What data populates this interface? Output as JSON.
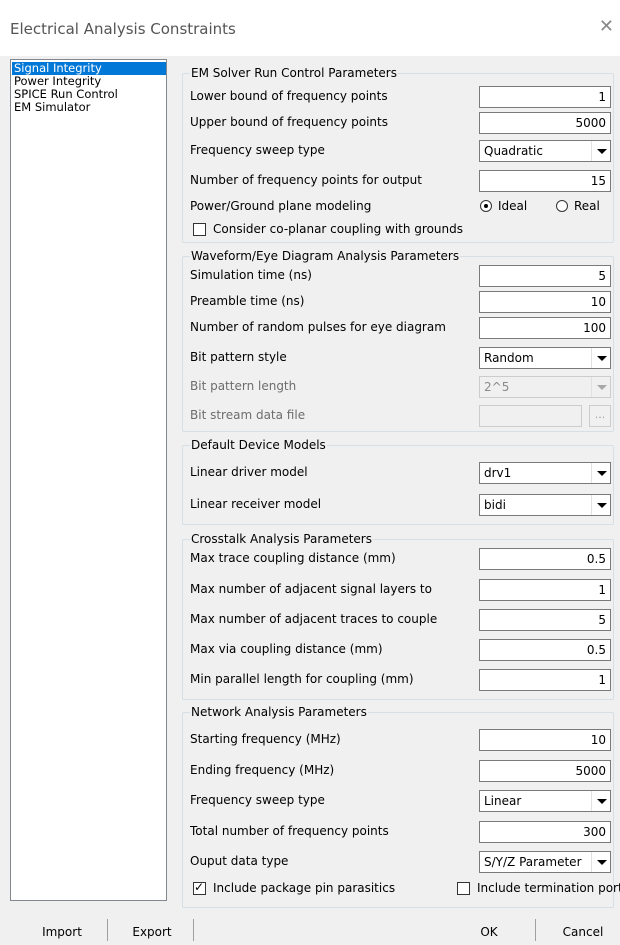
{
  "window": {
    "title": "Electrical Analysis Constraints",
    "close_glyph": "✕"
  },
  "sidebar": {
    "items": [
      {
        "label": "Signal Integrity",
        "selected": true
      },
      {
        "label": "Power Integrity"
      },
      {
        "label": "SPICE Run Control"
      },
      {
        "label": "EM Simulator"
      }
    ]
  },
  "em_solver": {
    "title": "EM Solver Run Control Parameters",
    "lower_bound": {
      "label": "Lower bound of frequency points",
      "value": "1"
    },
    "upper_bound": {
      "label": "Upper bound of frequency points",
      "value": "5000"
    },
    "sweep_type": {
      "label": "Frequency sweep type",
      "value": "Quadratic"
    },
    "output_points": {
      "label": "Number of frequency points for output",
      "value": "15"
    },
    "plane_modeling": {
      "label": "Power/Ground plane modeling",
      "option_ideal": "Ideal",
      "option_real": "Real",
      "selected": "Ideal"
    },
    "coplanar": {
      "label": "Consider co-planar coupling with grounds",
      "checked": false
    }
  },
  "waveform": {
    "title": "Waveform/Eye Diagram Analysis Parameters",
    "sim_time": {
      "label": "Simulation time (ns)",
      "value": "5"
    },
    "preamble": {
      "label": "Preamble time (ns)",
      "value": "10"
    },
    "random_pulses": {
      "label": "Number of random pulses for eye diagram",
      "value": "100"
    },
    "bit_style": {
      "label": "Bit pattern style",
      "value": "Random"
    },
    "bit_length": {
      "label": "Bit pattern length",
      "value": "2^5"
    },
    "bit_file": {
      "label": "Bit stream data file",
      "value": "",
      "browse": "..."
    }
  },
  "device_models": {
    "title": "Default Device Models",
    "driver": {
      "label": "Linear driver model",
      "value": "drv1"
    },
    "receiver": {
      "label": "Linear receiver model",
      "value": "bidi"
    }
  },
  "crosstalk": {
    "title": "Crosstalk Analysis Parameters",
    "trace_dist": {
      "label": "Max trace coupling distance (mm)",
      "value": "0.5"
    },
    "adj_layers": {
      "label": "Max number of adjacent signal layers to",
      "value": "1"
    },
    "adj_traces": {
      "label": "Max number of adjacent traces to couple",
      "value": "5"
    },
    "via_dist": {
      "label": "Max via coupling distance (mm)",
      "value": "0.5"
    },
    "parallel_len": {
      "label": "Min parallel length for coupling (mm)",
      "value": "1"
    }
  },
  "network": {
    "title": "Network Analysis Parameters",
    "start_freq": {
      "label": "Starting frequency (MHz)",
      "value": "10"
    },
    "end_freq": {
      "label": "Ending frequency (MHz)",
      "value": "5000"
    },
    "sweep_type": {
      "label": "Frequency sweep type",
      "value": "Linear"
    },
    "total_points": {
      "label": "Total number of frequency points",
      "value": "300"
    },
    "output_type": {
      "label": "Ouput data type",
      "value": "S/Y/Z Parameter"
    },
    "pkg_parasitics": {
      "label": "Include package pin parasitics",
      "checked": true
    },
    "term_port": {
      "label": "Include termination port",
      "checked": false
    }
  },
  "buttons": {
    "import": "Import",
    "export": "Export",
    "ok": "OK",
    "cancel": "Cancel"
  }
}
